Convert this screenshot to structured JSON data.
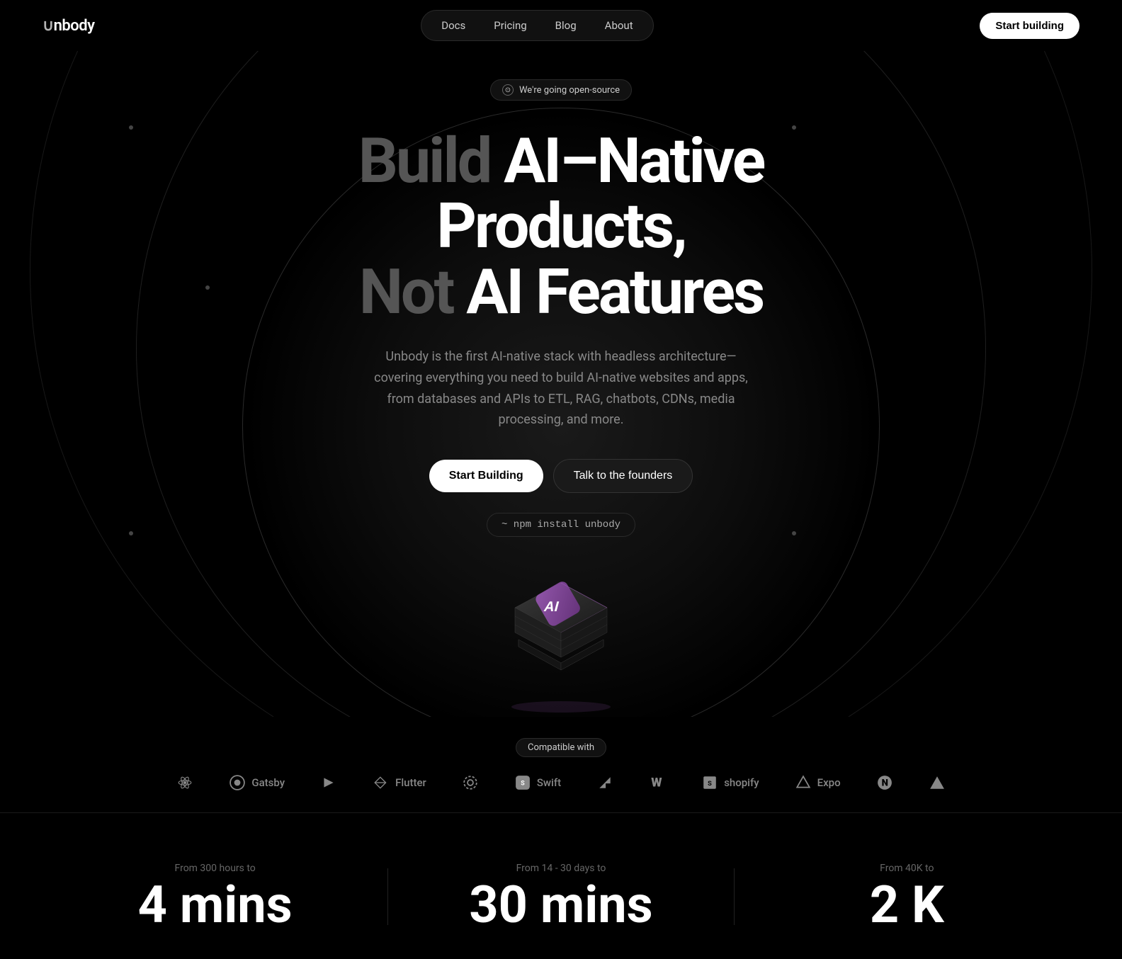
{
  "nav": {
    "logo": "Unbody",
    "links": [
      {
        "label": "Docs",
        "href": "#"
      },
      {
        "label": "Pricing",
        "href": "#"
      },
      {
        "label": "Blog",
        "href": "#"
      },
      {
        "label": "About",
        "href": "#"
      }
    ],
    "cta_label": "Start building"
  },
  "hero": {
    "badge_text": "We're going open-source",
    "title_line1_dim": "Build ",
    "title_line1_bright": "AI-Native Products,",
    "title_line2_dim": "Not ",
    "title_line2_bright": "AI Features",
    "subtitle": "Unbody is the first AI-native stack with headless architecture—covering everything you need to build AI-native websites and apps, from databases and APIs to ETL, RAG, chatbots, CDNs, media processing, and more.",
    "btn_primary": "Start Building",
    "btn_secondary": "Talk to the founders",
    "npm_command": "~ npm install unbody"
  },
  "compatible": {
    "badge_text": "Compatible with",
    "logos": [
      {
        "name": "React",
        "icon": "⚛"
      },
      {
        "name": "Gatsby",
        "icon": "G"
      },
      {
        "name": "Directus",
        "icon": "▶"
      },
      {
        "name": "Flutter",
        "icon": "F"
      },
      {
        "name": "Settings",
        "icon": "⚙"
      },
      {
        "name": "Swift",
        "icon": "S"
      },
      {
        "name": "Arrow",
        "icon": "↗"
      },
      {
        "name": "Webflow",
        "icon": "W"
      },
      {
        "name": "Shopify",
        "icon": "🛒"
      },
      {
        "name": "Expo",
        "icon": "Expo"
      },
      {
        "name": "Next.js",
        "icon": "N"
      },
      {
        "name": "Nuxt",
        "icon": "△"
      }
    ]
  },
  "stats": [
    {
      "label": "From 300 hours to",
      "value": "4 mins"
    },
    {
      "label": "From 14 - 30 days to",
      "value": "30 mins"
    },
    {
      "label": "From 40K to",
      "value": "2 K"
    }
  ]
}
